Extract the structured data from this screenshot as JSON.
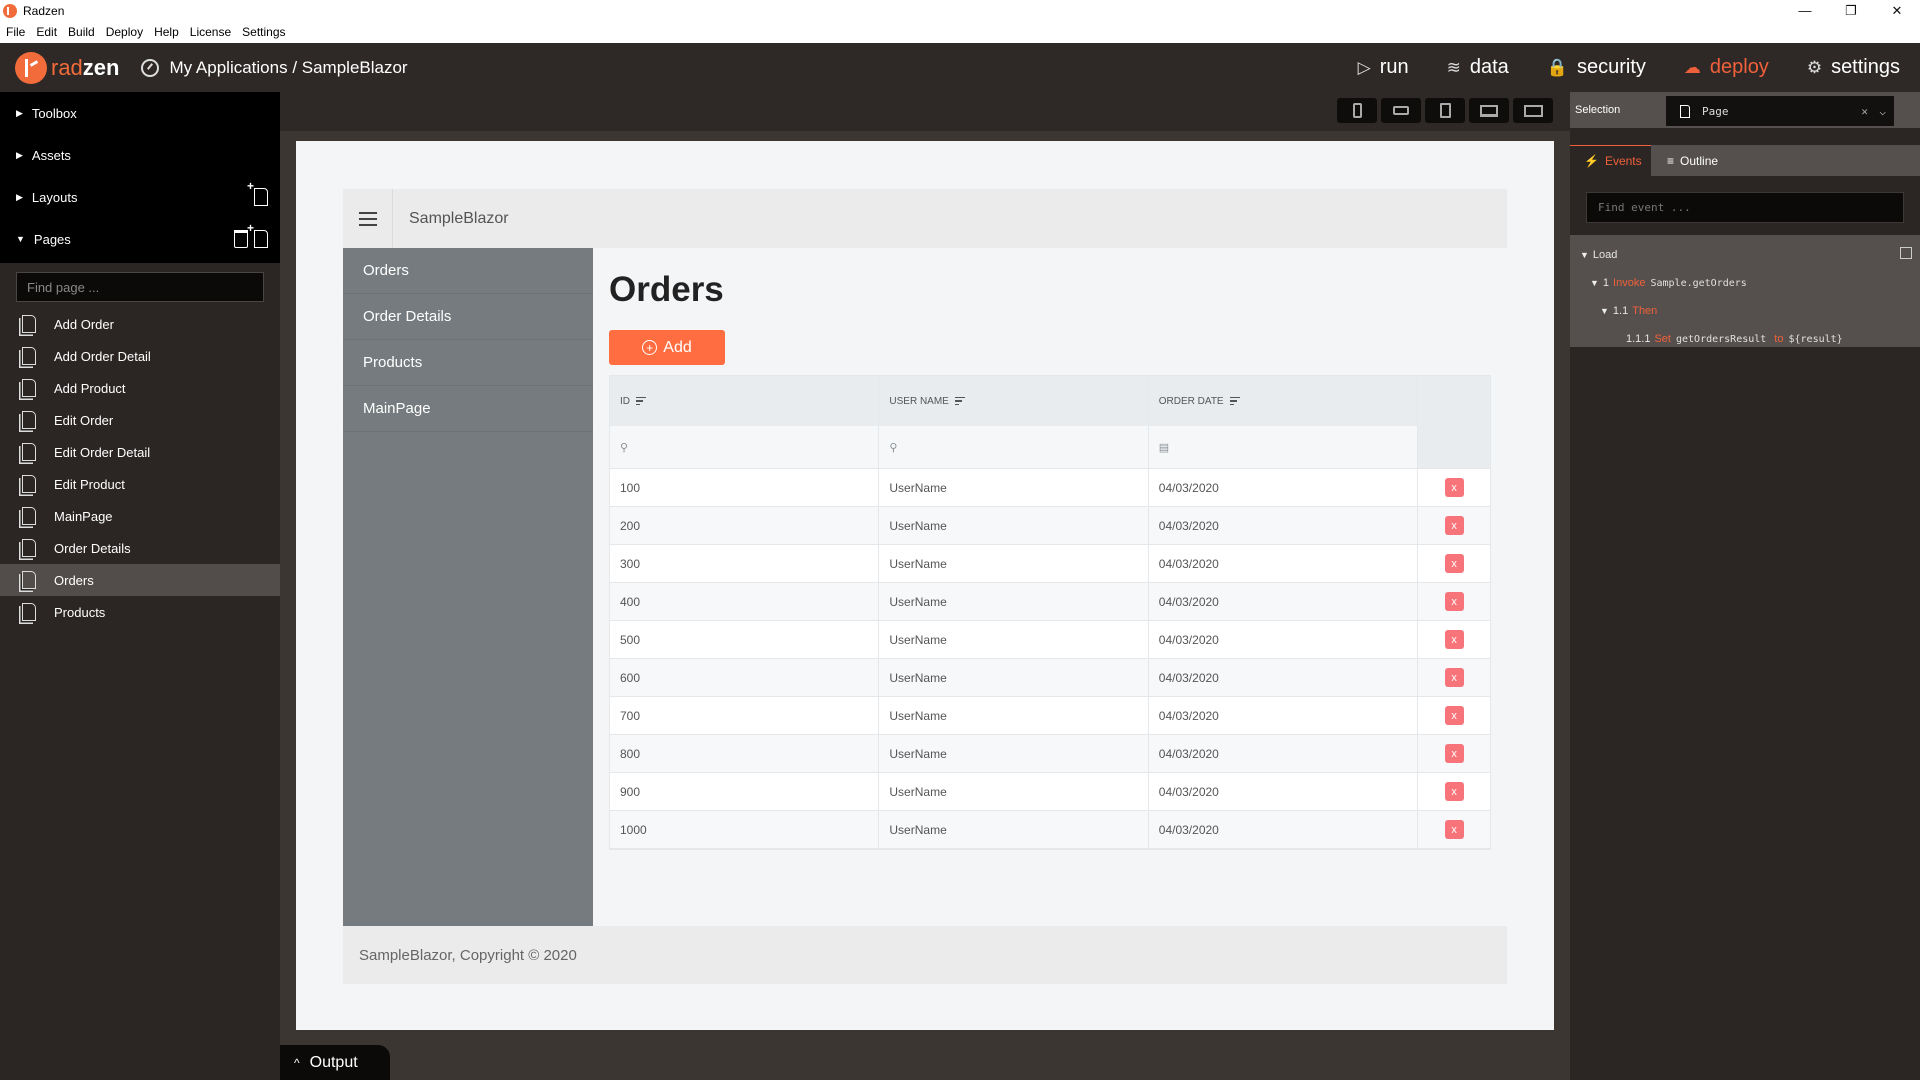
{
  "window": {
    "title": "Radzen",
    "controls": {
      "minimize": "—",
      "restore": "❐",
      "close": "✕"
    }
  },
  "menubar": [
    "File",
    "Edit",
    "Build",
    "Deploy",
    "Help",
    "License",
    "Settings"
  ],
  "header": {
    "logo_rad": "rad",
    "logo_zen": "zen",
    "breadcrumb": "My Applications / SampleBlazor",
    "nav": [
      {
        "label": "run",
        "icon": "▷"
      },
      {
        "label": "data",
        "icon": "≋"
      },
      {
        "label": "security",
        "icon": "🔒"
      },
      {
        "label": "deploy",
        "icon": "☁"
      },
      {
        "label": "settings",
        "icon": "⚙"
      }
    ],
    "accent_color": "#f0603a"
  },
  "left_panel": {
    "sections": [
      {
        "label": "Toolbox",
        "expanded": false
      },
      {
        "label": "Assets",
        "expanded": false
      },
      {
        "label": "Layouts",
        "expanded": false
      },
      {
        "label": "Pages",
        "expanded": true
      }
    ],
    "find_placeholder": "Find page ...",
    "pages": [
      "Add Order",
      "Add Order Detail",
      "Add Product",
      "Edit Order",
      "Edit Order Detail",
      "Edit Product",
      "MainPage",
      "Order Details",
      "Orders",
      "Products"
    ],
    "active_page": "Orders"
  },
  "canvas": {
    "device_buttons": [
      "phone-portrait",
      "phone-landscape",
      "tablet",
      "laptop",
      "desktop"
    ],
    "app_title": "SampleBlazor",
    "nav": [
      "Orders",
      "Order Details",
      "Products",
      "MainPage"
    ],
    "page_heading": "Orders",
    "add_label": "Add",
    "grid": {
      "columns": [
        "ID",
        "USER NAME",
        "ORDER DATE"
      ],
      "filter_icons": [
        "🔍",
        "🔍",
        "📅"
      ],
      "delete_label": "x",
      "rows": [
        [
          "100",
          "UserName",
          "04/03/2020"
        ],
        [
          "200",
          "UserName",
          "04/03/2020"
        ],
        [
          "300",
          "UserName",
          "04/03/2020"
        ],
        [
          "400",
          "UserName",
          "04/03/2020"
        ],
        [
          "500",
          "UserName",
          "04/03/2020"
        ],
        [
          "600",
          "UserName",
          "04/03/2020"
        ],
        [
          "700",
          "UserName",
          "04/03/2020"
        ],
        [
          "800",
          "UserName",
          "04/03/2020"
        ],
        [
          "900",
          "UserName",
          "04/03/2020"
        ],
        [
          "1000",
          "UserName",
          "04/03/2020"
        ]
      ]
    },
    "footer": "SampleBlazor, Copyright © 2020"
  },
  "output_tab": {
    "label": "Output",
    "icon": "^"
  },
  "right_panel": {
    "selection_label": "Selection",
    "selection_value": "Page",
    "tabs": [
      {
        "label": "Events",
        "icon": "⚡",
        "active": true
      },
      {
        "label": "Outline",
        "icon": "≡",
        "active": false
      }
    ],
    "find_event_placeholder": "Find event ...",
    "events": {
      "load": "Load",
      "step1_num": "1",
      "step1_kw": "Invoke",
      "step1_code": "Sample.getOrders",
      "step2_num": "1.1",
      "step2_kw": "Then",
      "step3_num": "1.1.1",
      "step3_kw": "Set",
      "step3_code": "getOrdersResult",
      "step3_to": "to",
      "step3_value": "${result}"
    }
  }
}
